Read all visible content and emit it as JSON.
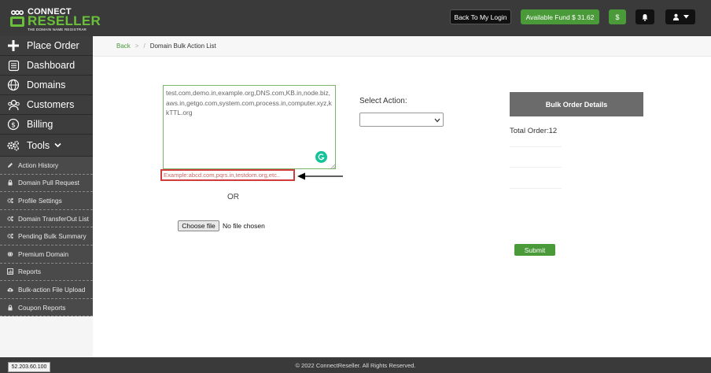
{
  "header": {
    "logo_line1": "CONNECT",
    "logo_line2": "RESELLER",
    "logo_tagline": "THE DOMAIN NAME REGISTRAR",
    "back_to_login": "Back To My Login",
    "available_fund": "Available Fund  $ 31.62",
    "dollar_label": "$"
  },
  "sidebar": {
    "main_items": [
      {
        "label": "Place Order",
        "icon": "plus-icon"
      },
      {
        "label": "Dashboard",
        "icon": "dashboard-icon"
      },
      {
        "label": "Domains",
        "icon": "globe-icon"
      },
      {
        "label": "Customers",
        "icon": "users-icon"
      },
      {
        "label": "Billing",
        "icon": "dollar-circle-icon"
      },
      {
        "label": "Tools",
        "icon": "gears-icon"
      }
    ],
    "sub_items": [
      {
        "label": "Action History",
        "icon": "pencil-icon"
      },
      {
        "label": "Domain Pull Request",
        "icon": "lock-icon"
      },
      {
        "label": "Profile Settings",
        "icon": "gears-icon"
      },
      {
        "label": "Domain TransferOut List",
        "icon": "gears-icon"
      },
      {
        "label": "Pending Bulk Summary",
        "icon": "gears-icon"
      },
      {
        "label": "Premium Domain",
        "icon": "globe-icon"
      },
      {
        "label": "Reports",
        "icon": "chart-icon"
      },
      {
        "label": "Bulk-action File Upload",
        "icon": "cloud-upload-icon"
      },
      {
        "label": "Coupon Reports",
        "icon": "lock-icon"
      }
    ]
  },
  "breadcrumb": {
    "back": "Back",
    "sep": ">",
    "sep2": "/",
    "current": "Domain Bulk Action List"
  },
  "form": {
    "domains_value": "test.com,demo.in,example.org,DNS.com,KB.in,node.biz,aws.in,getgo.com,system.com,process.in,computer.xyz,kkTTL.org",
    "example_hint": "Example:abcd.com,pqrs.in,testdom.org,etc..",
    "or_label": "OR",
    "choose_file": "Choose file",
    "no_file": "No file chosen",
    "select_action_label": "Select Action:",
    "select_action_value": ""
  },
  "summary": {
    "heading": "Bulk Order Details",
    "total_order": "Total Order:12",
    "submit": "Submit"
  },
  "footer": {
    "copyright": "© 2022 ConnectReseller. All Rights Reserved.",
    "ip": "52.203.60.100"
  },
  "colors": {
    "topbar": "#3a3a3a",
    "accent_green": "#4a9a3a",
    "sidebar_dark": "#3d3d3d",
    "highlight_red": "#d23b3b"
  }
}
